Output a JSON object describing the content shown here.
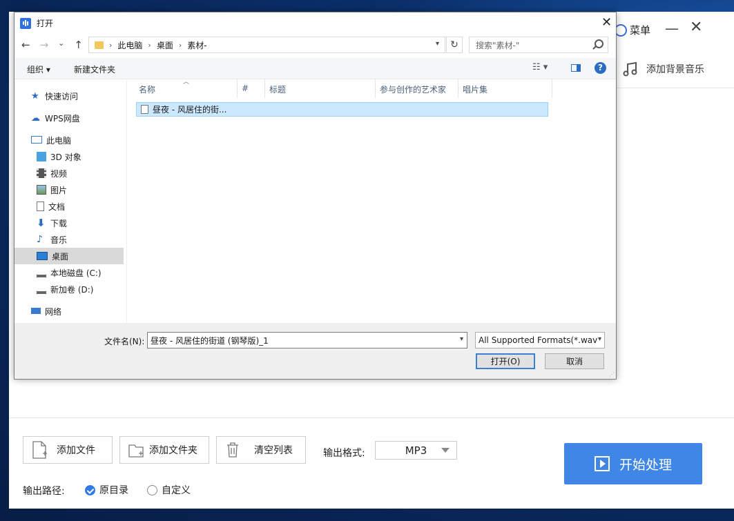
{
  "app": {
    "menu_label": "菜单",
    "minimize": "—",
    "close": "✕",
    "bgm_label": "添加背景音乐",
    "buttons": {
      "add_file": "添加文件",
      "add_folder": "添加文件夹",
      "clear_list": "清空列表"
    },
    "output_format_label": "输出格式:",
    "output_format_value": "MP3",
    "start_label": "开始处理",
    "output_path_label": "输出路径:",
    "output_path_options": [
      "原目录",
      "自定义"
    ],
    "output_path_selected": "原目录",
    "accent_color": "#3f86e6"
  },
  "dialog": {
    "title": "打开",
    "close": "✕",
    "nav": {
      "back": "←",
      "forward": "→",
      "recent": "⌄",
      "up": "↑"
    },
    "breadcrumb": [
      "此电脑",
      "桌面",
      "素材-"
    ],
    "search_placeholder": "搜索\"素材-\"",
    "toolbar": {
      "organize": "组织 ▾",
      "new_folder": "新建文件夹",
      "help": "?"
    },
    "sidebar": [
      {
        "label": "快速访问",
        "icon": "star-icon"
      },
      {
        "label": "WPS网盘",
        "icon": "cloud-icon"
      },
      {
        "label": "此电脑",
        "icon": "computer-icon"
      },
      {
        "label": "3D 对象",
        "icon": "cube-icon"
      },
      {
        "label": "视频",
        "icon": "video-icon"
      },
      {
        "label": "图片",
        "icon": "picture-icon"
      },
      {
        "label": "文档",
        "icon": "document-icon"
      },
      {
        "label": "下载",
        "icon": "download-icon"
      },
      {
        "label": "音乐",
        "icon": "music-icon"
      },
      {
        "label": "桌面",
        "icon": "desktop-icon",
        "selected": true
      },
      {
        "label": "本地磁盘 (C:)",
        "icon": "drive-icon"
      },
      {
        "label": "新加卷 (D:)",
        "icon": "drive-icon"
      },
      {
        "label": "网络",
        "icon": "network-icon"
      }
    ],
    "columns": [
      "名称",
      "#",
      "标题",
      "参与创作的艺术家",
      "唱片集"
    ],
    "files": [
      {
        "name": "昼夜 - 风居住的街..."
      }
    ],
    "filename_label": "文件名(N):",
    "filename_value": "昼夜 - 风居住的街道 (钢琴版)_1",
    "filetype_value": "All Supported Formats(*.wav",
    "open_button": "打开(O)",
    "cancel_button": "取消"
  }
}
